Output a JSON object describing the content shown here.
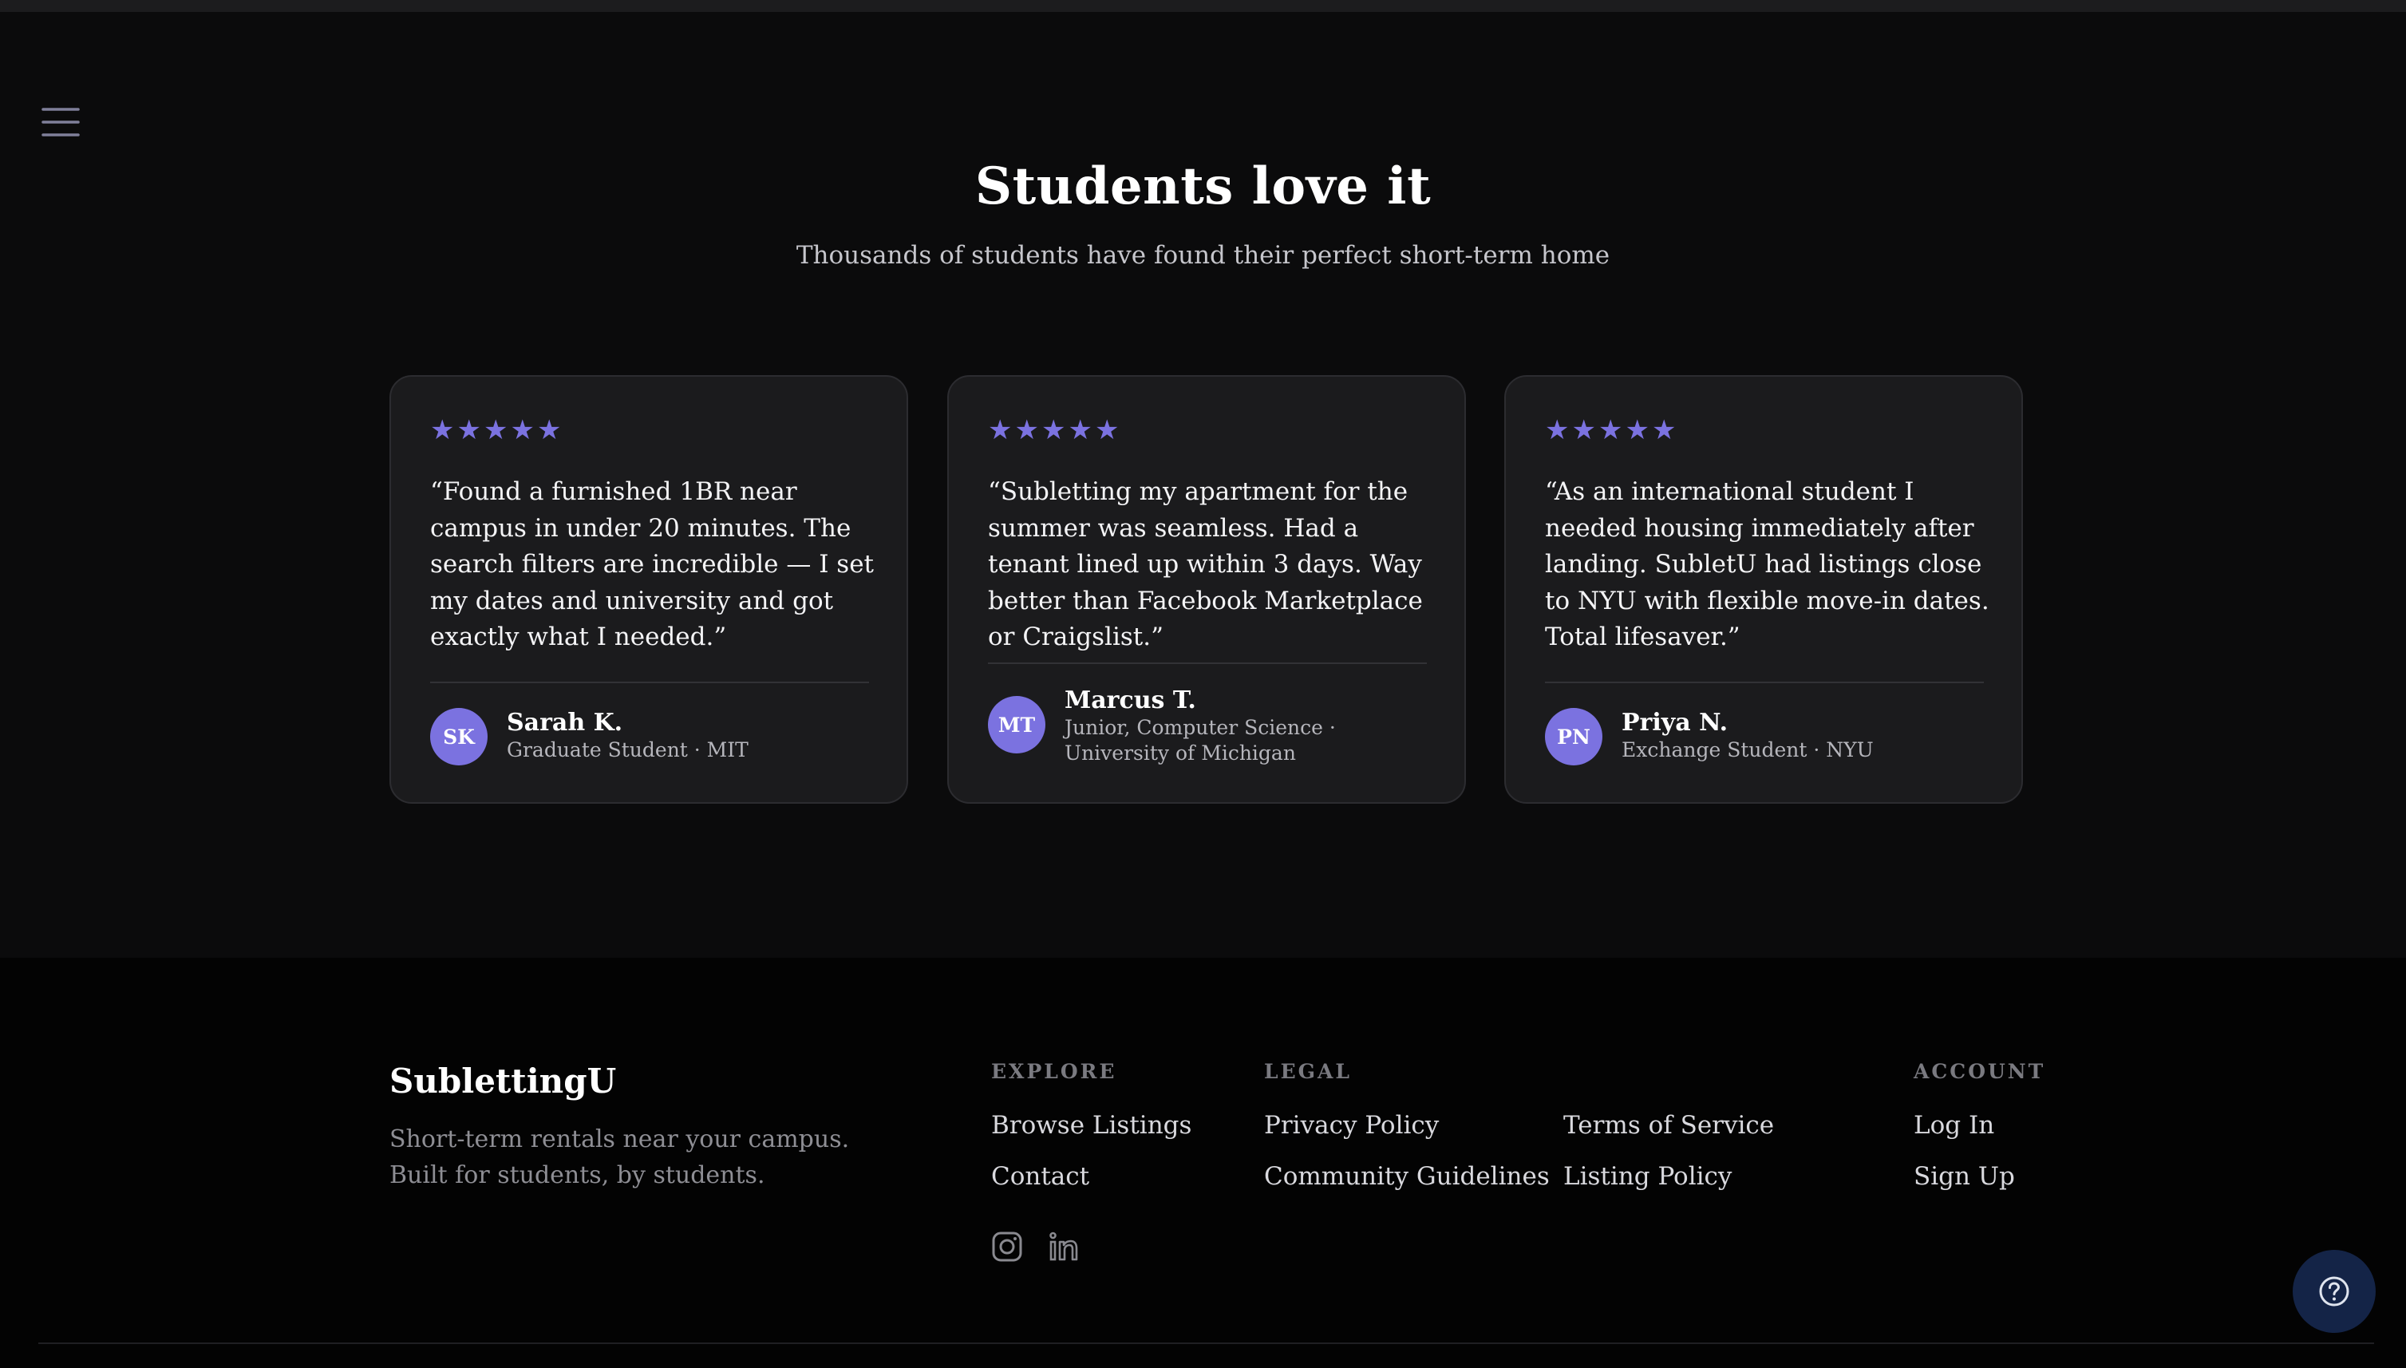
{
  "testimonials": {
    "title": "Students love it",
    "subtitle": "Thousands of students have found their perfect short-term home",
    "cards": [
      {
        "rating": 5,
        "stars": "★★★★★",
        "quote": "“Found a furnished 1BR near campus in under 20 minutes. The search filters are incredible — I set my dates and university and got exactly what I needed.”",
        "initials": "SK",
        "name": "Sarah K.",
        "meta": "Graduate Student · MIT"
      },
      {
        "rating": 5,
        "stars": "★★★★★",
        "quote": "“Subletting my apartment for the summer was seamless. Had a tenant lined up within 3 days. Way better than Facebook Marketplace or Craigslist.”",
        "initials": "MT",
        "name": "Marcus T.",
        "meta": "Junior, Computer Science · University of Michigan"
      },
      {
        "rating": 5,
        "stars": "★★★★★",
        "quote": "“As an international student I needed housing immediately after landing. SubletU had listings close to NYU with flexible move-in dates. Total lifesaver.”",
        "initials": "PN",
        "name": "Priya N.",
        "meta": "Exchange Student · NYU"
      }
    ]
  },
  "footer": {
    "brand": "SublettingU",
    "tagline": "Short-term rentals near your campus. Built for students, by students.",
    "explore": {
      "heading": "EXPLORE",
      "links": [
        "Browse Listings",
        "Contact"
      ]
    },
    "legal": {
      "heading": "LEGAL",
      "links": [
        "Privacy Policy",
        "Terms of Service",
        "Community Guidelines",
        "Listing Policy"
      ]
    },
    "account": {
      "heading": "ACCOUNT",
      "links": [
        "Log In",
        "Sign Up"
      ]
    },
    "social": [
      "instagram-icon",
      "linkedin-icon"
    ]
  },
  "icons": {
    "menu": "menu-icon",
    "help": "help-icon"
  },
  "colors": {
    "accent": "#7b72e0",
    "background": "#0b0b0c",
    "card": "#1b1b1d",
    "footer": "#030303",
    "help_button": "#142447"
  }
}
